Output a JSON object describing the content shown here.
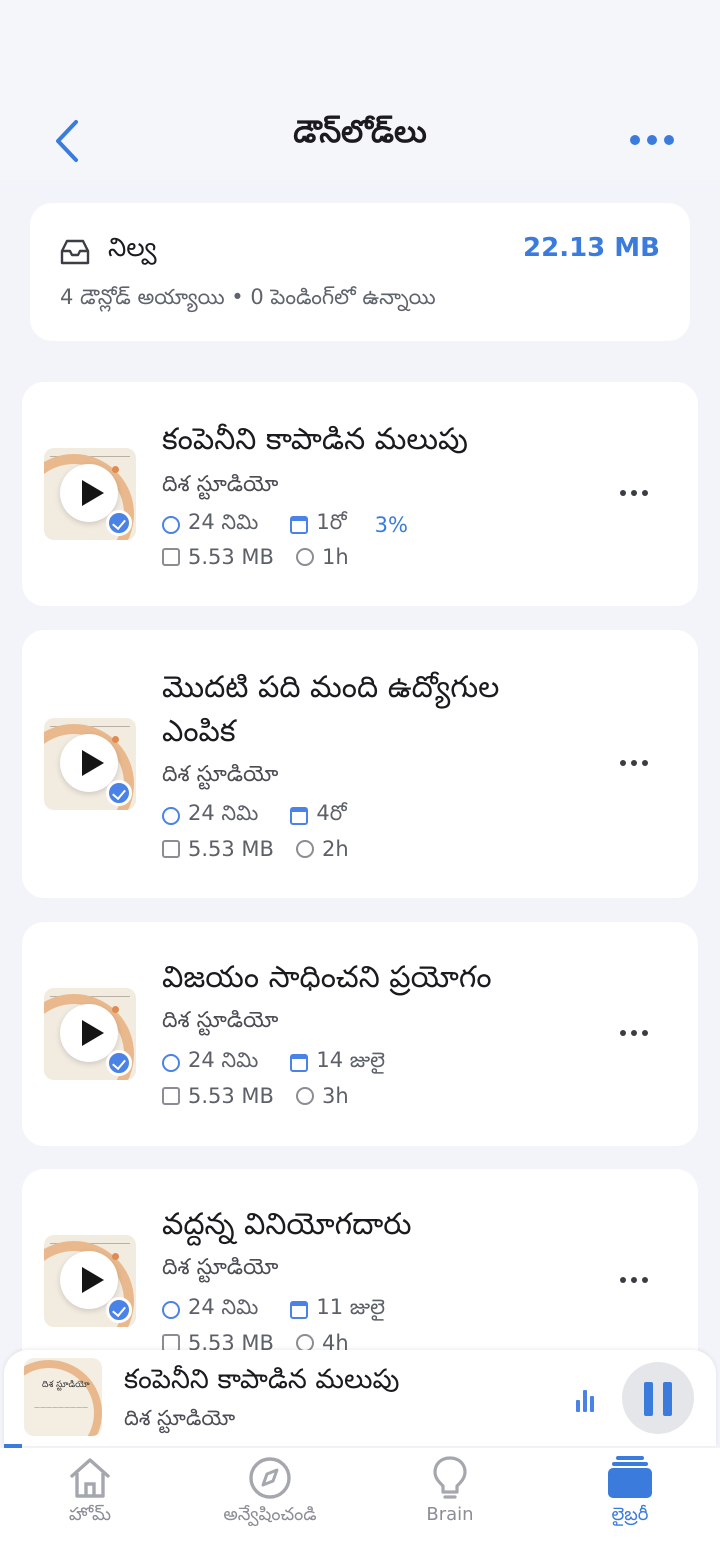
{
  "header": {
    "title": "డౌన్‌లోడ్‌లు"
  },
  "storage": {
    "title": "నిల్వ",
    "size": "22.13 MB",
    "summary": "4 డౌన్లోడ్ అయ్యాయి • 0 పెండింగ్‌లో ఉన్నాయి"
  },
  "episodes": [
    {
      "title": "కంపెనీని కాపాడిన మలుపు",
      "author": "దిశ స్టూడియో",
      "duration": "24 నిమి",
      "date": "1రో",
      "progress": "3%",
      "size": "5.53 MB",
      "age": "1h"
    },
    {
      "title": "మొదటి పది మంది ఉద్యోగుల ఎంపిక",
      "author": "దిశ స్టూడియో",
      "duration": "24 నిమి",
      "date": "4రో",
      "size": "5.53 MB",
      "age": "2h"
    },
    {
      "title": "విజయం సాధించని ప్రయోగం",
      "author": "దిశ స్టూడియో",
      "duration": "24 నిమి",
      "date": "14 జులై",
      "size": "5.53 MB",
      "age": "3h"
    },
    {
      "title": "వద్దన్న వినియోగదారు",
      "author": "దిశ స్టూడియో",
      "duration": "24 నిమి",
      "date": "11 జులై",
      "size": "5.53 MB",
      "age": "4h"
    }
  ],
  "player": {
    "title": "కంపెనీని కాపాడిన మలుపు",
    "author": "దిశ స్టూడియో",
    "thumb_label": "దిశ స్టూడియో",
    "progress": 0.025
  },
  "tabs": [
    {
      "label": "హోమ్",
      "icon": "home-icon"
    },
    {
      "label": "అన్వేషించండి",
      "icon": "compass-icon"
    },
    {
      "label": "Brain",
      "icon": "lightbulb-icon"
    },
    {
      "label": "లైబ్రరీ",
      "icon": "library-icon",
      "active": true
    }
  ],
  "colors": {
    "accent": "#3a7bdc",
    "background": "#f2f4f9",
    "card": "#ffffff"
  }
}
